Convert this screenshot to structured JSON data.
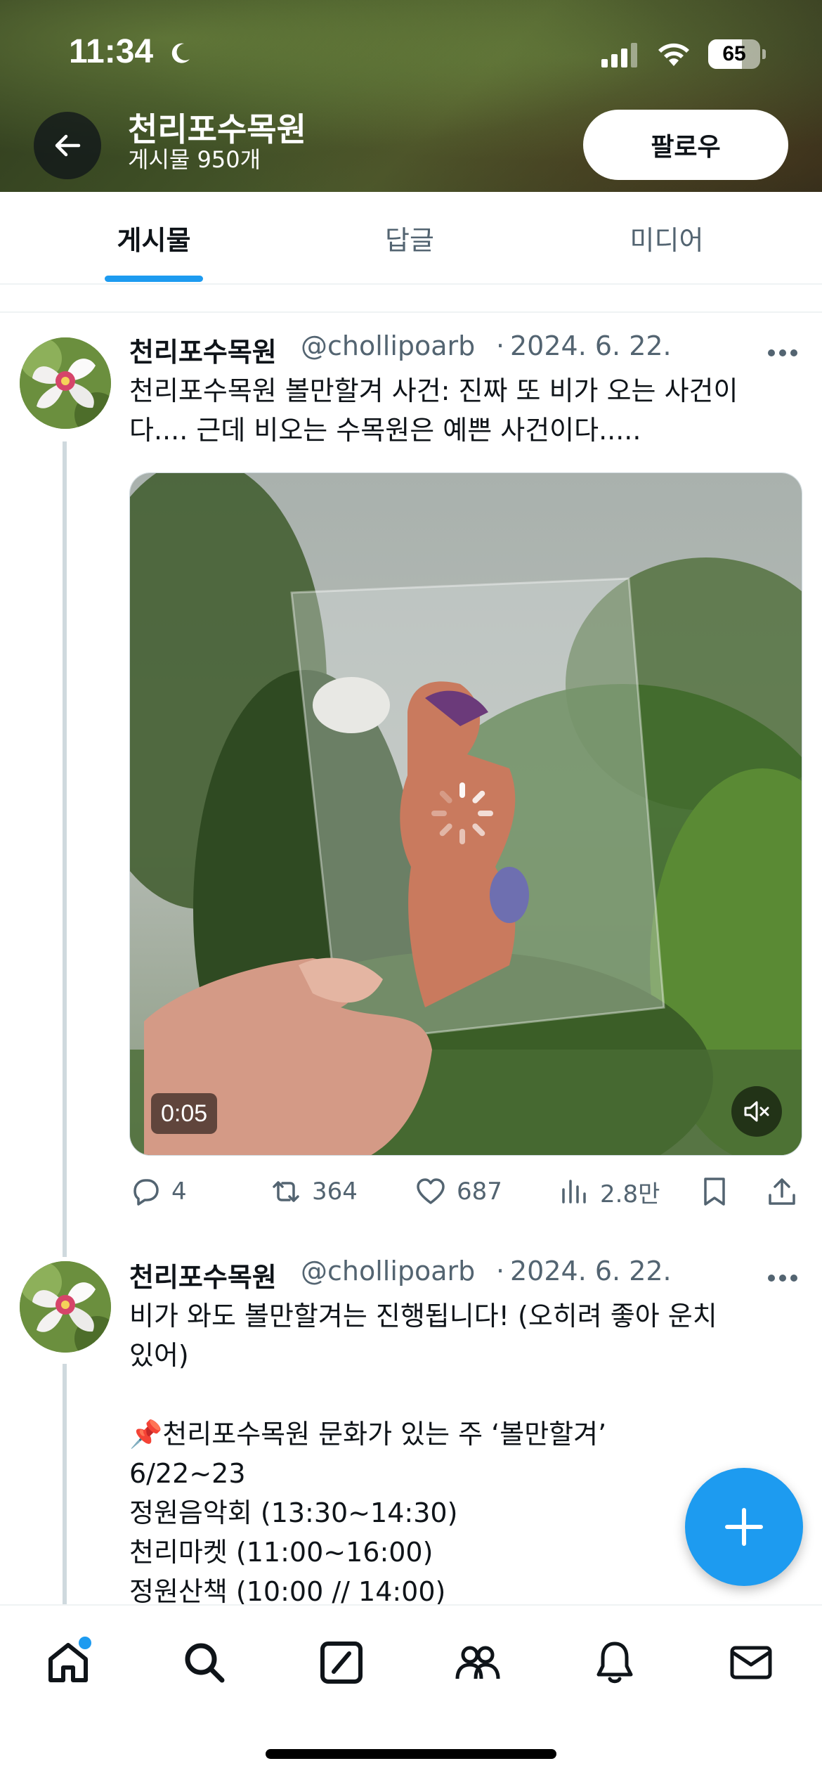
{
  "status_bar": {
    "time": "11:34",
    "battery_level": "65",
    "battery_fraction": 0.65
  },
  "header": {
    "profile_name": "천리포수목원",
    "post_count": "게시물 950개",
    "follow_label": "팔로우"
  },
  "tabs": [
    {
      "label": "게시물",
      "active": true
    },
    {
      "label": "답글",
      "active": false
    },
    {
      "label": "미디어",
      "active": false
    }
  ],
  "posts": [
    {
      "display_name": "천리포수목원",
      "handle": "@chollipoarb",
      "separator": "·",
      "date": "2024. 6. 22.",
      "text_lines": [
        "천리포수목원 볼만할겨 사건: 진짜 또 비가 오는 사건이",
        "다.... 근데 비오는 수목원은 예쁜 사건이다....."
      ],
      "video_duration": "0:05",
      "actions": {
        "replies": "4",
        "reposts": "364",
        "likes": "687",
        "views": "2.8만"
      }
    },
    {
      "display_name": "천리포수목원",
      "handle": "@chollipoarb",
      "separator": "·",
      "date": "2024. 6. 22.",
      "text_lines": [
        "비가 와도 볼만할겨는 진행됩니다! (오히려 좋아 운치",
        "있어)",
        "",
        "📌천리포수목원 문화가 있는 주 ‘볼만할겨’",
        "6/22~23",
        "정원음악회 (13:30~14:30)",
        "천리마켓 (11:00~16:00)",
        "정원산책 (10:00 // 14:00)"
      ]
    }
  ],
  "colors": {
    "accent": "#1d9bf0",
    "text_primary": "#0f1419",
    "text_secondary": "#536471",
    "border": "#eff3f4"
  },
  "bottom_nav": [
    {
      "icon": "home-icon",
      "active": true,
      "notification_dot": true
    },
    {
      "icon": "search-icon"
    },
    {
      "icon": "grok-icon"
    },
    {
      "icon": "communities-icon"
    },
    {
      "icon": "notifications-icon"
    },
    {
      "icon": "messages-icon"
    }
  ]
}
